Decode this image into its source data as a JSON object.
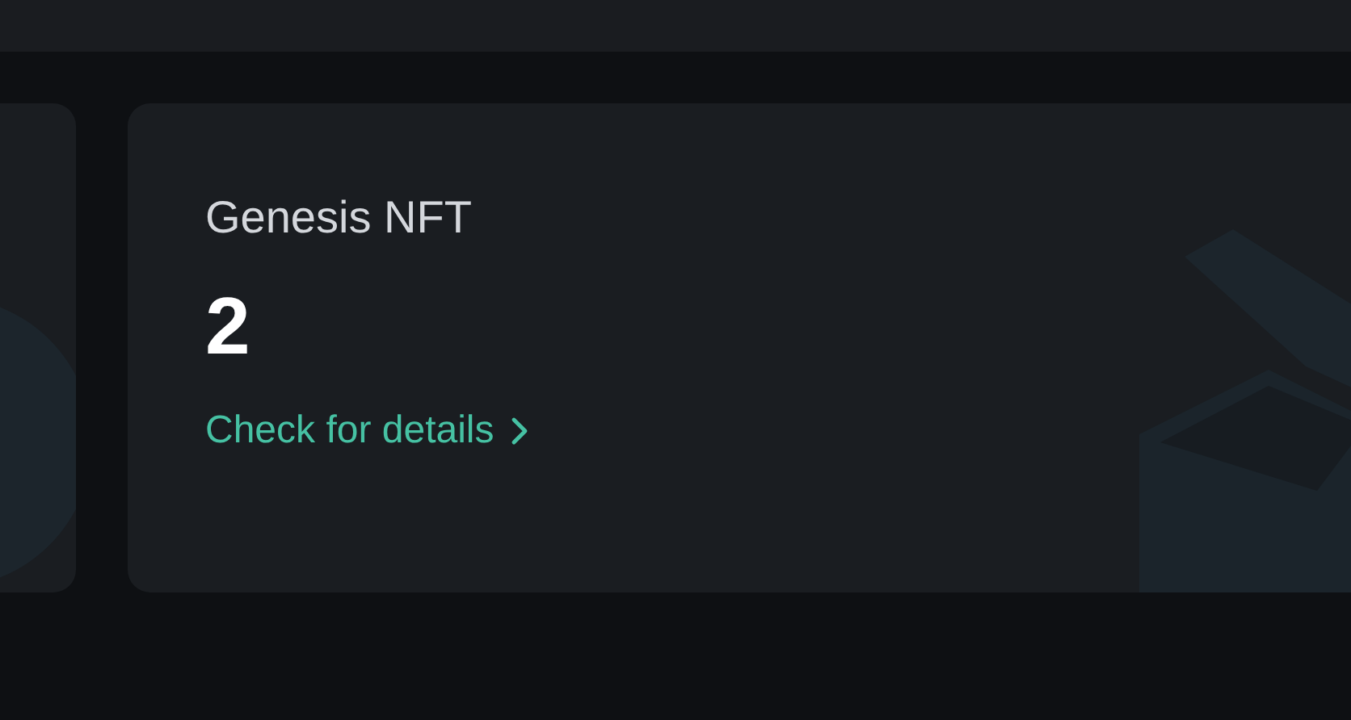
{
  "card": {
    "title": "Genesis NFT",
    "value": "2",
    "link": "Check for details"
  }
}
